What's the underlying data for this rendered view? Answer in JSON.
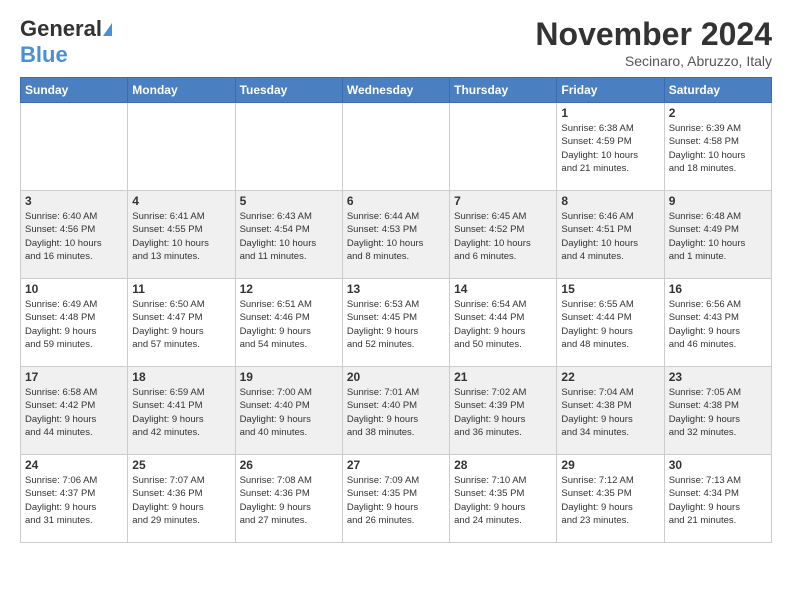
{
  "header": {
    "logo_general": "General",
    "logo_blue": "Blue",
    "month_title": "November 2024",
    "location": "Secinaro, Abruzzo, Italy"
  },
  "days_of_week": [
    "Sunday",
    "Monday",
    "Tuesday",
    "Wednesday",
    "Thursday",
    "Friday",
    "Saturday"
  ],
  "weeks": [
    [
      {
        "day": "",
        "info": ""
      },
      {
        "day": "",
        "info": ""
      },
      {
        "day": "",
        "info": ""
      },
      {
        "day": "",
        "info": ""
      },
      {
        "day": "",
        "info": ""
      },
      {
        "day": "1",
        "info": "Sunrise: 6:38 AM\nSunset: 4:59 PM\nDaylight: 10 hours\nand 21 minutes."
      },
      {
        "day": "2",
        "info": "Sunrise: 6:39 AM\nSunset: 4:58 PM\nDaylight: 10 hours\nand 18 minutes."
      }
    ],
    [
      {
        "day": "3",
        "info": "Sunrise: 6:40 AM\nSunset: 4:56 PM\nDaylight: 10 hours\nand 16 minutes."
      },
      {
        "day": "4",
        "info": "Sunrise: 6:41 AM\nSunset: 4:55 PM\nDaylight: 10 hours\nand 13 minutes."
      },
      {
        "day": "5",
        "info": "Sunrise: 6:43 AM\nSunset: 4:54 PM\nDaylight: 10 hours\nand 11 minutes."
      },
      {
        "day": "6",
        "info": "Sunrise: 6:44 AM\nSunset: 4:53 PM\nDaylight: 10 hours\nand 8 minutes."
      },
      {
        "day": "7",
        "info": "Sunrise: 6:45 AM\nSunset: 4:52 PM\nDaylight: 10 hours\nand 6 minutes."
      },
      {
        "day": "8",
        "info": "Sunrise: 6:46 AM\nSunset: 4:51 PM\nDaylight: 10 hours\nand 4 minutes."
      },
      {
        "day": "9",
        "info": "Sunrise: 6:48 AM\nSunset: 4:49 PM\nDaylight: 10 hours\nand 1 minute."
      }
    ],
    [
      {
        "day": "10",
        "info": "Sunrise: 6:49 AM\nSunset: 4:48 PM\nDaylight: 9 hours\nand 59 minutes."
      },
      {
        "day": "11",
        "info": "Sunrise: 6:50 AM\nSunset: 4:47 PM\nDaylight: 9 hours\nand 57 minutes."
      },
      {
        "day": "12",
        "info": "Sunrise: 6:51 AM\nSunset: 4:46 PM\nDaylight: 9 hours\nand 54 minutes."
      },
      {
        "day": "13",
        "info": "Sunrise: 6:53 AM\nSunset: 4:45 PM\nDaylight: 9 hours\nand 52 minutes."
      },
      {
        "day": "14",
        "info": "Sunrise: 6:54 AM\nSunset: 4:44 PM\nDaylight: 9 hours\nand 50 minutes."
      },
      {
        "day": "15",
        "info": "Sunrise: 6:55 AM\nSunset: 4:44 PM\nDaylight: 9 hours\nand 48 minutes."
      },
      {
        "day": "16",
        "info": "Sunrise: 6:56 AM\nSunset: 4:43 PM\nDaylight: 9 hours\nand 46 minutes."
      }
    ],
    [
      {
        "day": "17",
        "info": "Sunrise: 6:58 AM\nSunset: 4:42 PM\nDaylight: 9 hours\nand 44 minutes."
      },
      {
        "day": "18",
        "info": "Sunrise: 6:59 AM\nSunset: 4:41 PM\nDaylight: 9 hours\nand 42 minutes."
      },
      {
        "day": "19",
        "info": "Sunrise: 7:00 AM\nSunset: 4:40 PM\nDaylight: 9 hours\nand 40 minutes."
      },
      {
        "day": "20",
        "info": "Sunrise: 7:01 AM\nSunset: 4:40 PM\nDaylight: 9 hours\nand 38 minutes."
      },
      {
        "day": "21",
        "info": "Sunrise: 7:02 AM\nSunset: 4:39 PM\nDaylight: 9 hours\nand 36 minutes."
      },
      {
        "day": "22",
        "info": "Sunrise: 7:04 AM\nSunset: 4:38 PM\nDaylight: 9 hours\nand 34 minutes."
      },
      {
        "day": "23",
        "info": "Sunrise: 7:05 AM\nSunset: 4:38 PM\nDaylight: 9 hours\nand 32 minutes."
      }
    ],
    [
      {
        "day": "24",
        "info": "Sunrise: 7:06 AM\nSunset: 4:37 PM\nDaylight: 9 hours\nand 31 minutes."
      },
      {
        "day": "25",
        "info": "Sunrise: 7:07 AM\nSunset: 4:36 PM\nDaylight: 9 hours\nand 29 minutes."
      },
      {
        "day": "26",
        "info": "Sunrise: 7:08 AM\nSunset: 4:36 PM\nDaylight: 9 hours\nand 27 minutes."
      },
      {
        "day": "27",
        "info": "Sunrise: 7:09 AM\nSunset: 4:35 PM\nDaylight: 9 hours\nand 26 minutes."
      },
      {
        "day": "28",
        "info": "Sunrise: 7:10 AM\nSunset: 4:35 PM\nDaylight: 9 hours\nand 24 minutes."
      },
      {
        "day": "29",
        "info": "Sunrise: 7:12 AM\nSunset: 4:35 PM\nDaylight: 9 hours\nand 23 minutes."
      },
      {
        "day": "30",
        "info": "Sunrise: 7:13 AM\nSunset: 4:34 PM\nDaylight: 9 hours\nand 21 minutes."
      }
    ]
  ]
}
